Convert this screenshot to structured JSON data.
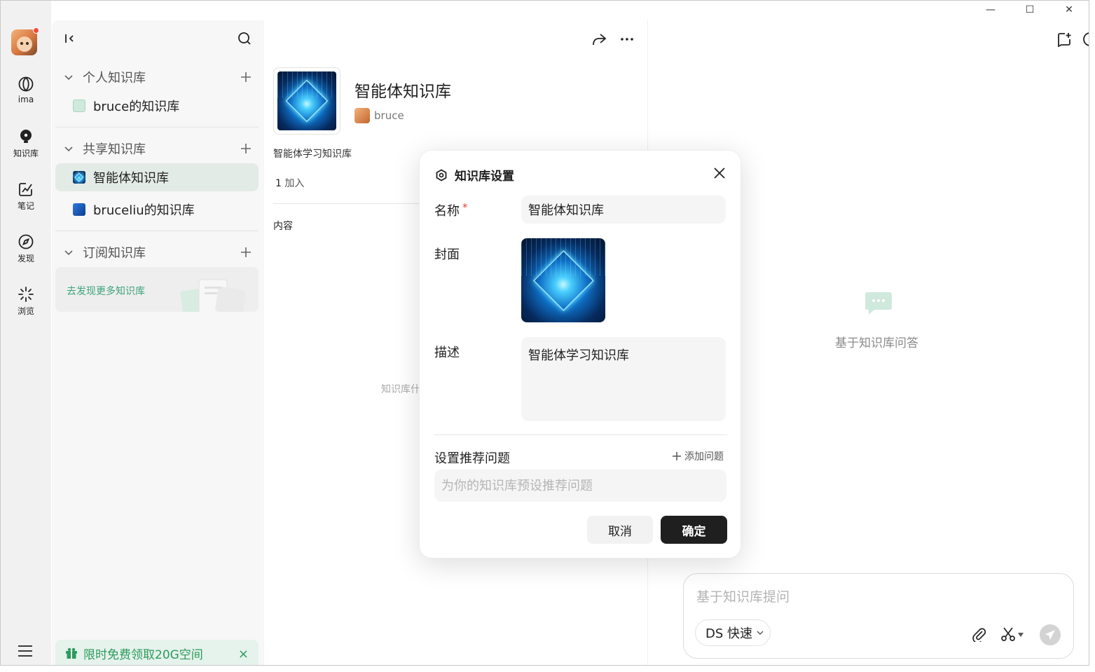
{
  "rail": {
    "items": [
      {
        "label": "ima",
        "icon": "ima-logo-icon"
      },
      {
        "label": "知识库",
        "icon": "lightbulb-icon"
      },
      {
        "label": "笔记",
        "icon": "note-edit-icon"
      },
      {
        "label": "发现",
        "icon": "compass-icon"
      },
      {
        "label": "浏览",
        "icon": "sparkle-icon"
      }
    ],
    "notification_color": "#f24b3c"
  },
  "sidebar": {
    "sections": [
      {
        "title": "个人知识库",
        "items": [
          {
            "label": "bruce的知识库"
          }
        ]
      },
      {
        "title": "共享知识库",
        "items": [
          {
            "label": "智能体知识库",
            "active": true
          },
          {
            "label": "bruceliu的知识库"
          }
        ]
      },
      {
        "title": "订阅知识库",
        "items": []
      }
    ],
    "discover_text": "去发现更多知识库",
    "promo_text": "限时免费领取20G空间",
    "promo_close": "×",
    "accent_color": "#2b9a5b"
  },
  "detail": {
    "title": "智能体知识库",
    "owner": "bruce",
    "description": "智能体学习知识库",
    "join_count": "1",
    "join_label": " 加入",
    "content_label": "内容",
    "empty_text": "知识库什"
  },
  "qa": {
    "empty_text": "基于知识库问答",
    "input_placeholder": "基于知识库提问",
    "model_label": "DS 快速"
  },
  "modal": {
    "title": "知识库设置",
    "name_label": "名称",
    "required_mark": "*",
    "name_value": "智能体知识库",
    "cover_label": "封面",
    "desc_label": "描述",
    "desc_value": "智能体学习知识库",
    "rec_label": "设置推荐问题",
    "add_question": "添加问题",
    "rec_placeholder": "为你的知识库预设推荐问题",
    "cancel": "取消",
    "confirm": "确定"
  },
  "window": {
    "minimize": "—",
    "maximize": "☐",
    "close": "✕"
  }
}
